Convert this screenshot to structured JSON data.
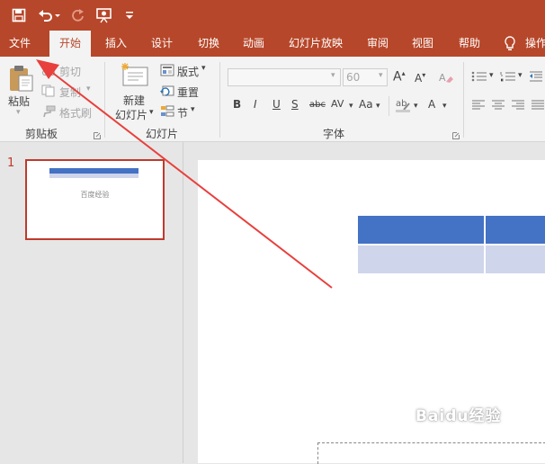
{
  "quick_access": {
    "icons": [
      "save-icon",
      "undo-icon",
      "redo-icon",
      "start-slideshow-icon",
      "customize-qat-icon"
    ]
  },
  "tabs": [
    {
      "label": "文件"
    },
    {
      "label": "开始"
    },
    {
      "label": "插入"
    },
    {
      "label": "设计"
    },
    {
      "label": "切换"
    },
    {
      "label": "动画"
    },
    {
      "label": "幻灯片放映"
    },
    {
      "label": "审阅"
    },
    {
      "label": "视图"
    },
    {
      "label": "帮助"
    },
    {
      "label": "操作"
    }
  ],
  "ribbon": {
    "clipboard": {
      "paste": "粘贴",
      "cut": "剪切",
      "copy": "复制",
      "format_painter": "格式刷",
      "group_label": "剪贴板"
    },
    "slides": {
      "new_slide_line1": "新建",
      "new_slide_line2": "幻灯片",
      "layout": "版式",
      "reset": "重置",
      "section": "节",
      "group_label": "幻灯片"
    },
    "font": {
      "font_size": "60",
      "group_label": "字体",
      "buttons": [
        "B",
        "I",
        "U",
        "S",
        "abc",
        "AV",
        "Aa",
        "A"
      ]
    }
  },
  "thumbnail": {
    "number": "1",
    "caption": "百度经验"
  },
  "watermark": "Baidu经验",
  "colors": {
    "accent": "#b7472a",
    "table_header": "#4472c4",
    "table_row": "#cfd5ea",
    "arrow": "#e8403d",
    "selection": "#c0392b"
  }
}
